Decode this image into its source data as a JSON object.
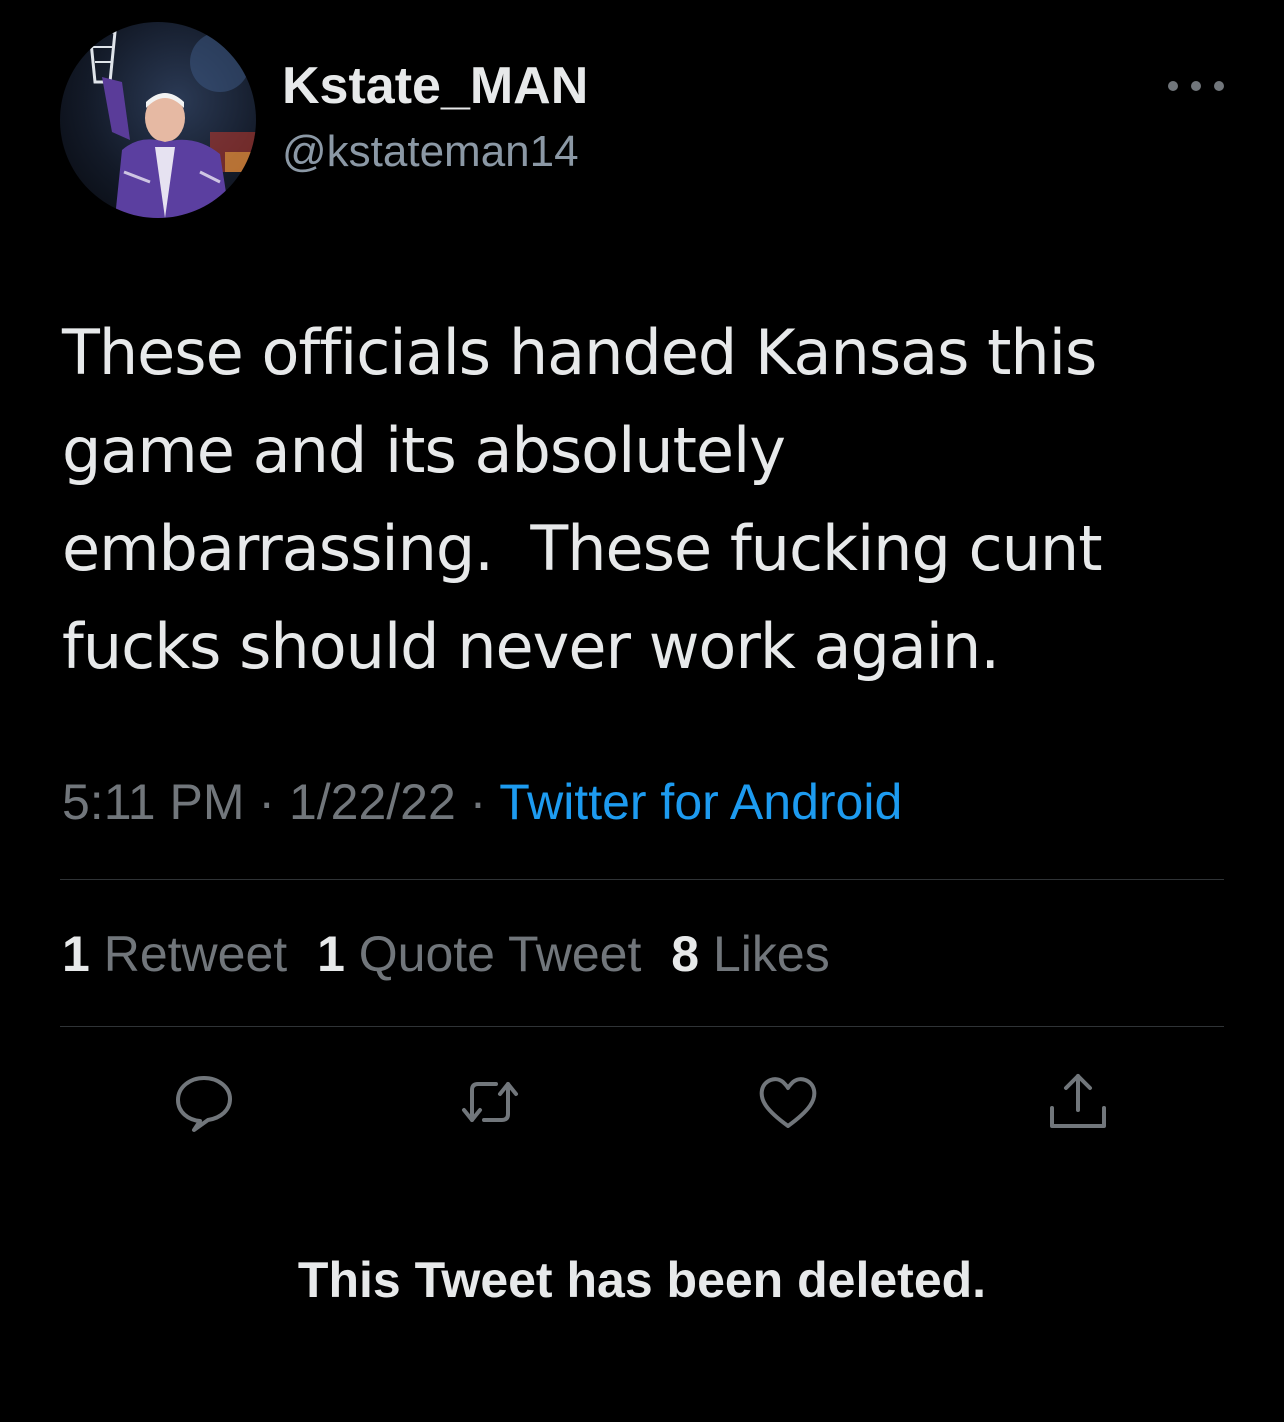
{
  "tweet": {
    "display_name": "Kstate_MAN",
    "handle": "@kstateman14",
    "text": "These officials handed Kansas this\ngame and its absolutely\nembarrassing.  These fucking cunt\nfucks should never work again.",
    "time": "5:11 PM",
    "date": "1/22/22",
    "separator": " · ",
    "source": "Twitter for Android"
  },
  "stats": {
    "retweets_count": "1",
    "retweets_label": "Retweet",
    "quotes_count": "1",
    "quotes_label": "Quote Tweet",
    "likes_count": "8",
    "likes_label": "Likes"
  },
  "actions": {
    "icons": [
      "reply-icon",
      "retweet-icon",
      "like-icon",
      "share-icon"
    ]
  },
  "notice": {
    "deleted_text": "This Tweet has been deleted."
  },
  "colors": {
    "background": "#000000",
    "text_primary": "#e7e9ea",
    "text_secondary": "#71767b",
    "link": "#1d9bf0",
    "divider": "#2f3336"
  }
}
